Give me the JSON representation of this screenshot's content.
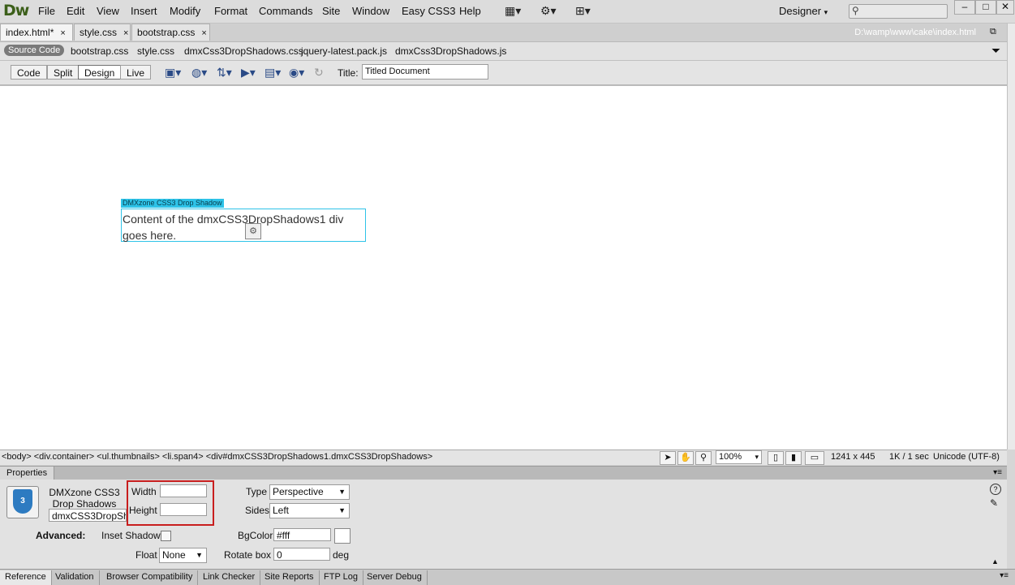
{
  "app": {
    "logo": "Dw",
    "workspace": "Designer"
  },
  "menu": [
    "File",
    "Edit",
    "View",
    "Insert",
    "Modify",
    "Format",
    "Commands",
    "Site",
    "Window",
    "Easy CSS3",
    "Help"
  ],
  "tabs": [
    {
      "label": "index.html*",
      "close": "×"
    },
    {
      "label": "style.css",
      "close": "×"
    },
    {
      "label": "bootstrap.css",
      "close": "×"
    }
  ],
  "file_path": "D:\\wamp\\www\\cake\\index.html",
  "related_files": {
    "source_code": "Source Code",
    "files": [
      "bootstrap.css",
      "style.css",
      "dmxCss3DropShadows.css",
      "jquery-latest.pack.js",
      "dmxCss3DropShadows.js"
    ]
  },
  "doc_toolbar": {
    "views": [
      "Code",
      "Split",
      "Design",
      "Live"
    ],
    "title_label": "Title:",
    "title_value": "Titled Document"
  },
  "canvas": {
    "widget_label": "DMXzone CSS3 Drop Shadow",
    "widget_text": "Content of the dmxCSS3DropShadows1 div goes here."
  },
  "status": {
    "tag_selector": "<body> <div.container> <ul.thumbnails> <li.span4> <div#dmxCSS3DropShadows1.dmxCSS3DropShadows>",
    "zoom": "100%",
    "size": "1241 x 445",
    "download": "1K / 1 sec",
    "encoding": "Unicode (UTF-8)"
  },
  "properties": {
    "header": "Properties",
    "component_name": "DMXzone CSS3 Drop Shadows",
    "component_id": "dmxCSS3DropShad",
    "width_label": "Width",
    "width_value": "",
    "height_label": "Height",
    "height_value": "",
    "type_label": "Type",
    "type_value": "Perspective",
    "sides_label": "Sides",
    "sides_value": "Left",
    "advanced_label": "Advanced:",
    "inset_label": "Inset Shadow",
    "bgcolor_label": "BgColor",
    "bgcolor_value": "#fff",
    "float_label": "Float",
    "float_value": "None",
    "rotate_label": "Rotate box",
    "rotate_value": "0",
    "rotate_unit": "deg"
  },
  "bottom_tabs": [
    "Reference",
    "Validation",
    "Browser Compatibility",
    "Link Checker",
    "Site Reports",
    "FTP Log",
    "Server Debug"
  ],
  "colors": {
    "highlight": "#c81e1e",
    "widget_accent": "#2ec3e8"
  }
}
